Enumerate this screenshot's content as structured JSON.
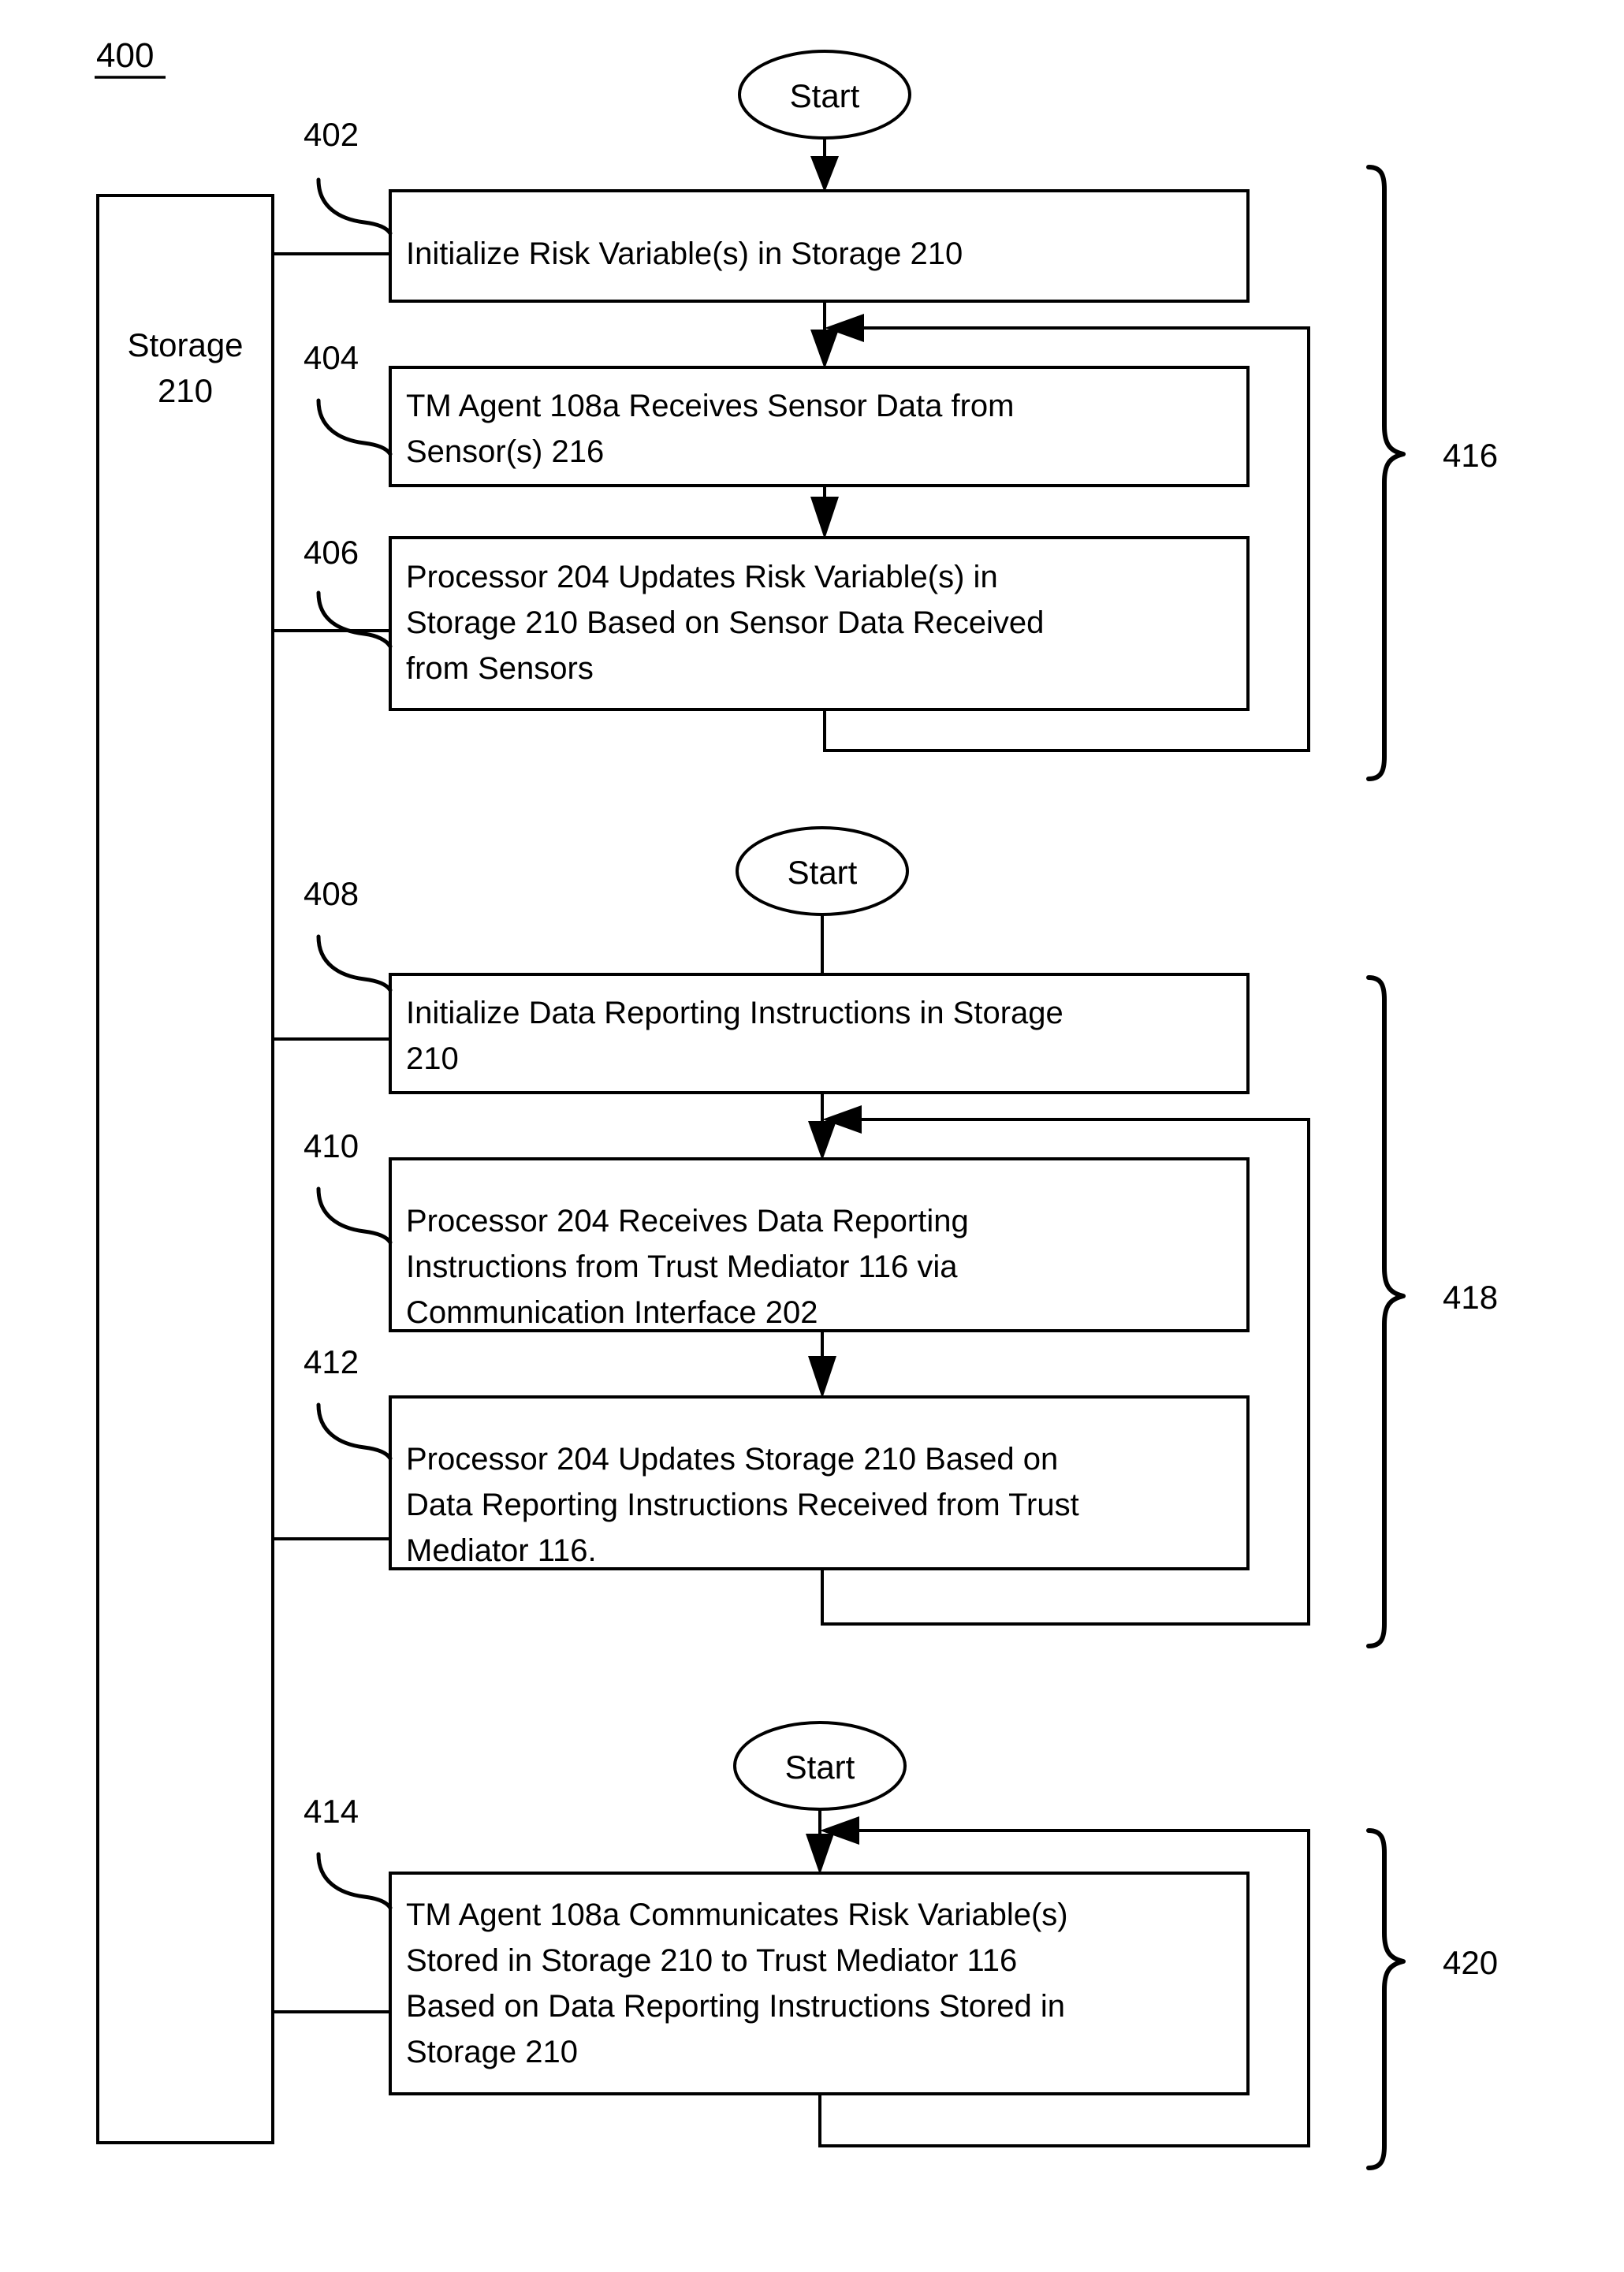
{
  "figure": {
    "number": "400"
  },
  "storage": {
    "line1": "Storage",
    "line2": "210"
  },
  "start_nodes": [
    {
      "id": "start-1",
      "label": "Start"
    },
    {
      "id": "start-2",
      "label": "Start"
    },
    {
      "id": "start-3",
      "label": "Start"
    }
  ],
  "steps": [
    {
      "ref": "402",
      "lines": [
        "Initialize Risk Variable(s) in Storage 210"
      ]
    },
    {
      "ref": "404",
      "lines": [
        "TM Agent 108a Receives Sensor Data from",
        "Sensor(s) 216"
      ]
    },
    {
      "ref": "406",
      "lines": [
        "Processor 204 Updates Risk Variable(s) in",
        "Storage 210 Based on Sensor Data Received",
        "from Sensors"
      ]
    },
    {
      "ref": "408",
      "lines": [
        "Initialize Data Reporting Instructions in Storage",
        "210"
      ]
    },
    {
      "ref": "410",
      "lines": [
        "Processor 204 Receives Data Reporting",
        "Instructions from Trust Mediator 116 via",
        "Communication Interface 202"
      ]
    },
    {
      "ref": "412",
      "lines": [
        "Processor 204 Updates Storage 210 Based on",
        "Data Reporting Instructions Received from Trust",
        "Mediator 116."
      ]
    },
    {
      "ref": "414",
      "lines": [
        "TM Agent 108a Communicates Risk Variable(s)",
        "Stored in Storage 210 to Trust Mediator 116",
        "Based on Data Reporting Instructions Stored in",
        "Storage 210"
      ]
    }
  ],
  "groups": [
    {
      "ref": "416"
    },
    {
      "ref": "418"
    },
    {
      "ref": "420"
    }
  ],
  "colors": {
    "ink": "#000000",
    "paper": "#ffffff"
  }
}
